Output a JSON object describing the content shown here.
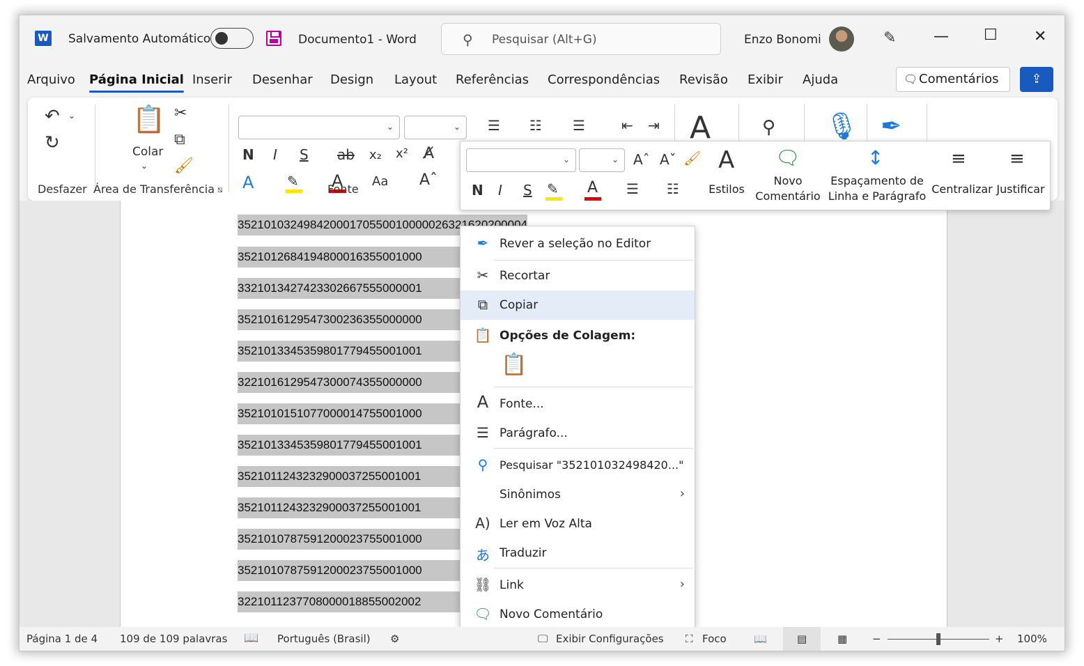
{
  "titlebar": {
    "app_icon": "word-logo-icon",
    "app_letter": "W",
    "autosave_label": "Salvamento Automático",
    "document": "Documento1  -  Word",
    "search_placeholder": "Pesquisar (Alt+G)",
    "user": "Enzo Bonomi"
  },
  "tabs": [
    "Arquivo",
    "Página Inicial",
    "Inserir",
    "Desenhar",
    "Design",
    "Layout",
    "Referências",
    "Correspondências",
    "Revisão",
    "Exibir",
    "Ajuda"
  ],
  "active_tab": "Página Inicial",
  "comments_button": "Comentários",
  "ribbon": {
    "groups": [
      "Desfazer",
      "Área de Transferência",
      "Fonte"
    ],
    "paste_label": "Colar",
    "bold": "N",
    "italic": "I",
    "underline": "S",
    "strike": "ab",
    "subscript": "x₂",
    "superscript": "x²",
    "case": "Aa"
  },
  "mini_toolbar": {
    "styles_label": "Estilos",
    "new_comment_label": [
      "Novo",
      "Comentário"
    ],
    "spacing_label": [
      "Espaçamento de",
      "Linha e Parágrafo"
    ],
    "center_label": "Centralizar",
    "justify_label": "Justificar"
  },
  "document_lines": [
    "35210103249842000170550010000026321620200004",
    "3521012684194800016355001000",
    "3321013427423302667555000001",
    "3521016129547300236355000000",
    "3521013345359801779455001001",
    "3221016129547300074355000000",
    "3521010151077000014755001000",
    "3521013345359801779455001001",
    "3521011243232900037255001001",
    "3521011243232900037255001001",
    "3521010787591200023755001000",
    "3521010787591200023755001000",
    "3221011237708000018855002002"
  ],
  "context_menu": [
    {
      "icon": "editor-pen-icon",
      "label": "Rever a seleção no Editor"
    },
    {
      "icon": "scissors-icon",
      "label": "Recortar"
    },
    {
      "icon": "copy-icon",
      "label": "Copiar",
      "highlighted": true
    },
    {
      "icon": "paste-icon",
      "label": "Opções de Colagem:"
    },
    {
      "icon": "font-icon",
      "label": "Fonte..."
    },
    {
      "icon": "paragraph-icon",
      "label": "Parágrafo..."
    },
    {
      "icon": "smart-search-icon",
      "label": "Pesquisar \"352101032498420...\""
    },
    {
      "icon": "",
      "label": "Sinônimos"
    },
    {
      "icon": "read-aloud-icon",
      "label": "Ler em Voz Alta"
    },
    {
      "icon": "translate-icon",
      "label": "Traduzir"
    },
    {
      "icon": "link-icon",
      "label": "Link"
    },
    {
      "icon": "new-comment-icon",
      "label": "Novo Comentário"
    }
  ],
  "status": {
    "page": "Página 1 de 4",
    "words": "109 de 109 palavras",
    "language": "Português (Brasil)",
    "display_settings": "Exibir Configurações",
    "focus": "Foco",
    "zoom": "100%"
  },
  "colors": {
    "accent": "#185abd",
    "highlight": "#ffe600",
    "font_color": "#e00000",
    "selection": "#c6c6c6"
  }
}
